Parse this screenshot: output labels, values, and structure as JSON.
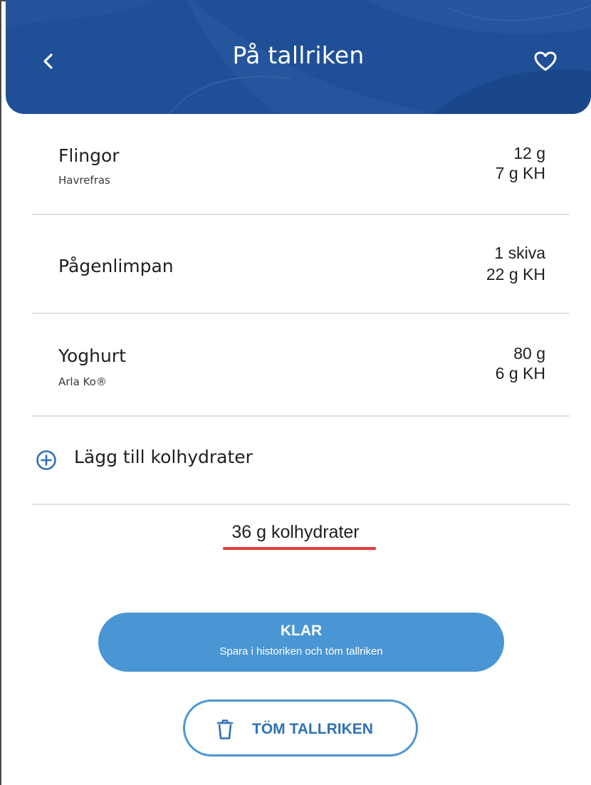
{
  "header": {
    "title": "På tallriken",
    "back_icon": "chevron-left-icon",
    "favorite_icon": "heart-outline-icon",
    "background_color": "#1f4f96"
  },
  "plate_items": [
    {
      "name": "Flingor",
      "brand": "Havrefras",
      "amount": "12 g",
      "carbs": "7 g KH"
    },
    {
      "name": "Pågenlimpan",
      "brand": "",
      "amount": "1 skiva",
      "carbs": "22 g KH"
    },
    {
      "name": "Yoghurt",
      "brand": "Arla Ko®",
      "amount": "80 g",
      "carbs": "6 g KH"
    }
  ],
  "add_carbs": {
    "label": "Lägg till kolhydrater",
    "icon": "plus-circle-icon"
  },
  "total": {
    "text": "36 g kolhydrater",
    "underline_color": "#e63b3b"
  },
  "done_button": {
    "label": "KLAR",
    "sublabel": "Spara i historiken och töm tallriken",
    "color": "#4a95d4"
  },
  "clear_button": {
    "label": "TÖM TALLRIKEN",
    "icon": "trash-icon"
  }
}
